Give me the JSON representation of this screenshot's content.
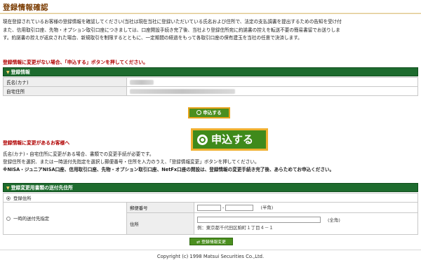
{
  "page": {
    "title": "登録情報確認"
  },
  "intro": {
    "line1": "現在登録されているお客様の登録情報を確認してください(当社は現在当社に登録いただいている氏名および住所で、法定の支払調書を提出するための告知を受け付",
    "line2": "また、信用取引口座、先物・オプション取引口座につきましては、口座開設手続き完了後、当社より登録住所宛に約諾書の控えを転送不要の簡易書留でお送りしま",
    "line3": "す。約諾書の控えが返戻された場合、新規取引を制限するとともに、一定期間の経過をもって各取引口座の保有建玉を当社の任意で決済します。"
  },
  "no_change_note": "登録情報に変更がない場合、「申込する」ボタンを押してください。",
  "registration": {
    "section_title": "登録情報",
    "rows": [
      {
        "label": "氏名(カナ)"
      },
      {
        "label": "自宅住所"
      }
    ]
  },
  "apply": {
    "small_label": "申込する",
    "big_label": "申込する"
  },
  "change": {
    "title": "登録情報に変更があるお客様へ",
    "line1": "氏名(カナ)・自宅住所に変更がある場合、書類での変更手続が必要です。",
    "line2": "登録住所を選択、または一時送付先指定を選択し郵便番号・住所を入力のうえ、「登録情報変更」ボタンを押してください。",
    "line3": "※NISA・ジュニアNISA口座、信用取引口座、先物・オプション取引口座、NetFx口座の開設は、登録情報の変更手続き完了後、あらためてお申込ください。"
  },
  "mailing": {
    "section_title": "登録変更用書類の送付先住所",
    "option_registered": "登録住所",
    "option_temporary": "一時的送付先指定",
    "postal_label": "郵便番号",
    "postal_hint": "(半角)",
    "postal_separator": "-",
    "address_label": "住所",
    "address_hint": "(全角)",
    "address_example": "例：東京都千代田区駒町１丁目４－１"
  },
  "change_button": {
    "label": "登録情報変更"
  },
  "footer": {
    "copyright": "Copyright (c) 1998 Matsui Securities Co.,Ltd."
  },
  "colors": {
    "section_green": "#1d6b2e",
    "button_green": "#4b8f1f",
    "highlight_orange": "#f0b030",
    "note_red": "#b00000"
  }
}
